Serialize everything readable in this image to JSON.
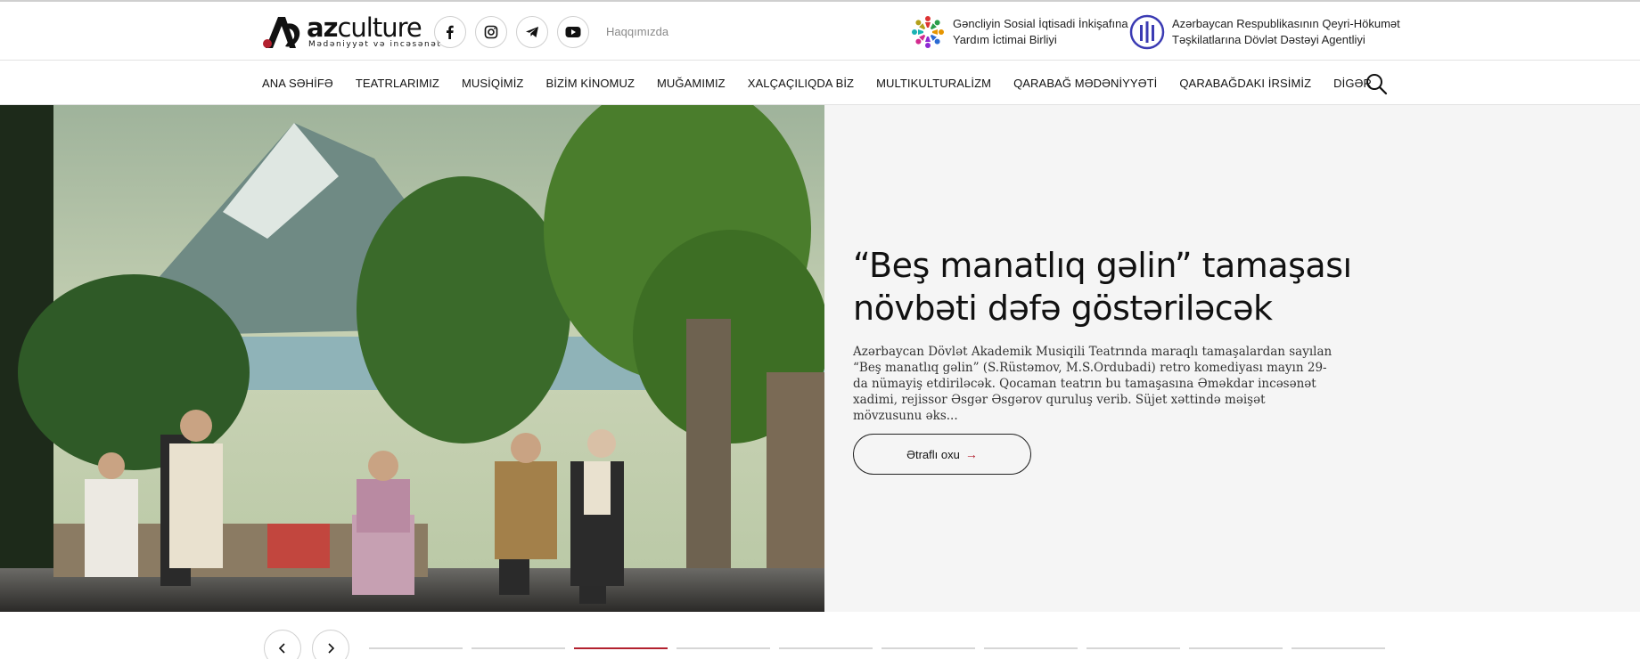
{
  "header": {
    "logo": {
      "word_bold": "az",
      "word_light": "culture",
      "subtitle": "Mədəniyyət və incəsənət"
    },
    "socials": [
      {
        "name": "facebook-icon"
      },
      {
        "name": "instagram-icon"
      },
      {
        "name": "telegram-icon"
      },
      {
        "name": "youtube-icon"
      }
    ],
    "about_link": "Haqqımızda",
    "partners": [
      {
        "line1": "Gəncliyin Sosial İqtisadi İnkişafına",
        "line2": "Yardım İctimai Birliyi"
      },
      {
        "line1": "Azərbaycan Respublikasının Qeyri-Hökumət",
        "line2": "Təşkilatlarına Dövlət Dəstəyi Agentliyi"
      }
    ]
  },
  "nav": {
    "items": [
      "ANA SƏHİFƏ",
      "TEATRLARIMIZ",
      "MUSİQİMİZ",
      "BİZİM KİNOMUZ",
      "MUĞAMIMIZ",
      "XALÇAÇILIQDA BİZ",
      "MULTIKULTURALİZM",
      "QARABAĞ MƏDƏNİYYƏTİ",
      "QARABAĞDAKI İRSİMİZ",
      "DİGƏR"
    ],
    "search_icon": "search-icon"
  },
  "hero": {
    "title": "“Beş manatlıq gəlin” tamaşası növbəti dəfə göstəriləcək",
    "excerpt": "Azərbaycan Dövlət Akademik Musiqili Teatrında maraqlı tamaşalardan sayılan “Beş manatlıq gəlin” (S.Rüstəmov, M.S.Ordubadi) retro komediyası mayın 29-da nümayiş etdiriləcək.   Qocaman teatrın bu tamaşasına Əməkdar incəsənət xadimi, rejissor Əsgər Əsgərov quruluş verib.   Süjet xəttində məişət mövzusunu əks...",
    "read_more": "Ətraflı oxu",
    "read_more_arrow": "→"
  },
  "slider": {
    "total_slides": 10,
    "active_index": 2
  },
  "colors": {
    "accent": "#b3212f",
    "hero_bg": "#f5f5f5",
    "border": "#e2e2e2"
  }
}
